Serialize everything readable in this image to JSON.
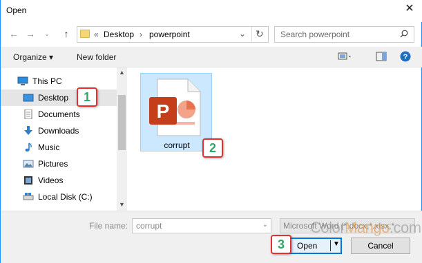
{
  "window": {
    "title": "Open"
  },
  "address": {
    "crumbs": [
      "«",
      "Desktop",
      "›",
      "powerpoint"
    ]
  },
  "search": {
    "placeholder": "Search powerpoint"
  },
  "toolbar": {
    "organize": "Organize ▾",
    "new_folder": "New folder"
  },
  "nav": {
    "items": [
      {
        "label": "This PC",
        "icon": "pc-icon"
      },
      {
        "label": "Desktop",
        "icon": "desktop-icon",
        "selected": true
      },
      {
        "label": "Documents",
        "icon": "documents-icon"
      },
      {
        "label": "Downloads",
        "icon": "downloads-icon"
      },
      {
        "label": "Music",
        "icon": "music-icon"
      },
      {
        "label": "Pictures",
        "icon": "pictures-icon"
      },
      {
        "label": "Videos",
        "icon": "videos-icon"
      },
      {
        "label": "Local Disk (C:)",
        "icon": "drive-icon"
      }
    ]
  },
  "files": [
    {
      "name": "corrupt",
      "icon": "powerpoint-file-icon"
    }
  ],
  "bottom": {
    "file_name_label": "File name:",
    "file_name_value": "corrupt",
    "file_type": "Microsoft Word (*.docx;*.xlsx;*",
    "open_label": "Open",
    "cancel_label": "Cancel"
  },
  "watermark": {
    "text_a": "Color",
    "text_b": "Mango",
    "text_c": ".com"
  },
  "badges": [
    "1",
    "2",
    "3"
  ],
  "colors": {
    "accent": "#0078d7",
    "selection": "#cce8ff",
    "badge_border": "#e03030",
    "badge_text": "#2fa86a",
    "ppt_red": "#c43e1c"
  }
}
